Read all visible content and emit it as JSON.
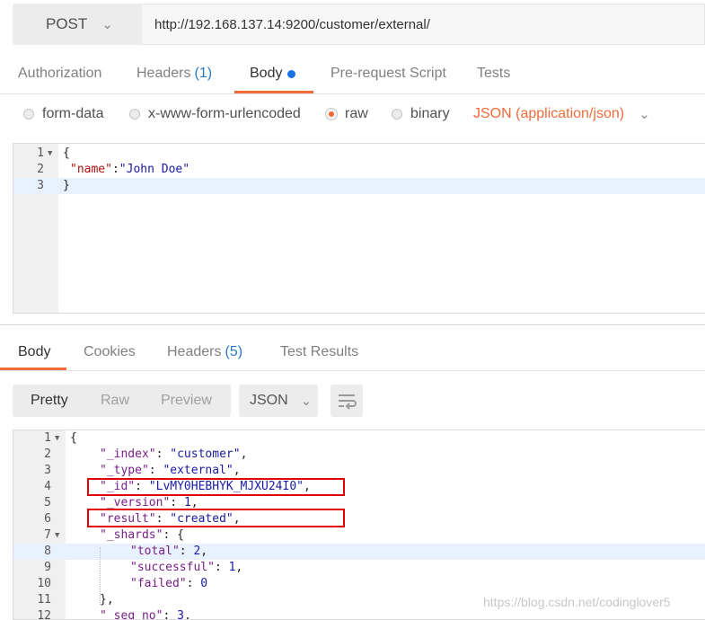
{
  "request": {
    "method": "POST",
    "url": "http://192.168.137.14:9200/customer/external/"
  },
  "request_tabs": [
    {
      "label": "Authorization",
      "count": ""
    },
    {
      "label": "Headers",
      "count": "(1)"
    },
    {
      "label": "Body",
      "count": ""
    },
    {
      "label": "Pre-request Script",
      "count": ""
    },
    {
      "label": "Tests",
      "count": ""
    }
  ],
  "body_types": {
    "form_data": "form-data",
    "urlencoded": "x-www-form-urlencoded",
    "raw": "raw",
    "binary": "binary",
    "content_type": "JSON (application/json)"
  },
  "request_body_lines": [
    {
      "num": "1",
      "text": "{"
    },
    {
      "num": "2",
      "key": "\"name\"",
      "sep": ":",
      "val": "\"John Doe\""
    },
    {
      "num": "3",
      "text": "}"
    }
  ],
  "response_tabs": [
    {
      "label": "Body",
      "count": ""
    },
    {
      "label": "Cookies",
      "count": ""
    },
    {
      "label": "Headers",
      "count": "(5)"
    },
    {
      "label": "Test Results",
      "count": ""
    }
  ],
  "view_modes": [
    "Pretty",
    "Raw",
    "Preview"
  ],
  "format": "JSON",
  "response_lines": [
    {
      "num": "1",
      "text": "{"
    },
    {
      "num": "2",
      "key": "\"_index\"",
      "val": "\"customer\"",
      "end": ","
    },
    {
      "num": "3",
      "key": "\"_type\"",
      "val": "\"external\"",
      "end": ","
    },
    {
      "num": "4",
      "key": "\"_id\"",
      "val": "\"LvMY0HEBHYK_MJXU24I0\"",
      "end": ","
    },
    {
      "num": "5",
      "key": "\"_version\"",
      "val": "1",
      "end": ","
    },
    {
      "num": "6",
      "key": "\"result\"",
      "val": "\"created\"",
      "end": ","
    },
    {
      "num": "7",
      "key": "\"_shards\"",
      "val": "{",
      "end": ""
    },
    {
      "num": "8",
      "key": "\"total\"",
      "val": "2",
      "end": ","
    },
    {
      "num": "9",
      "key": "\"successful\"",
      "val": "1",
      "end": ","
    },
    {
      "num": "10",
      "key": "\"failed\"",
      "val": "0",
      "end": ""
    },
    {
      "num": "11",
      "text": "},"
    },
    {
      "num": "12",
      "key": "\"_seq_no\"",
      "val": "3",
      "end": ","
    }
  ],
  "watermark": "https://blog.csdn.net/codinglover5",
  "colors": {
    "accent": "#f26b3a",
    "link": "#2a7acb",
    "highlight_box": "#e00000"
  }
}
